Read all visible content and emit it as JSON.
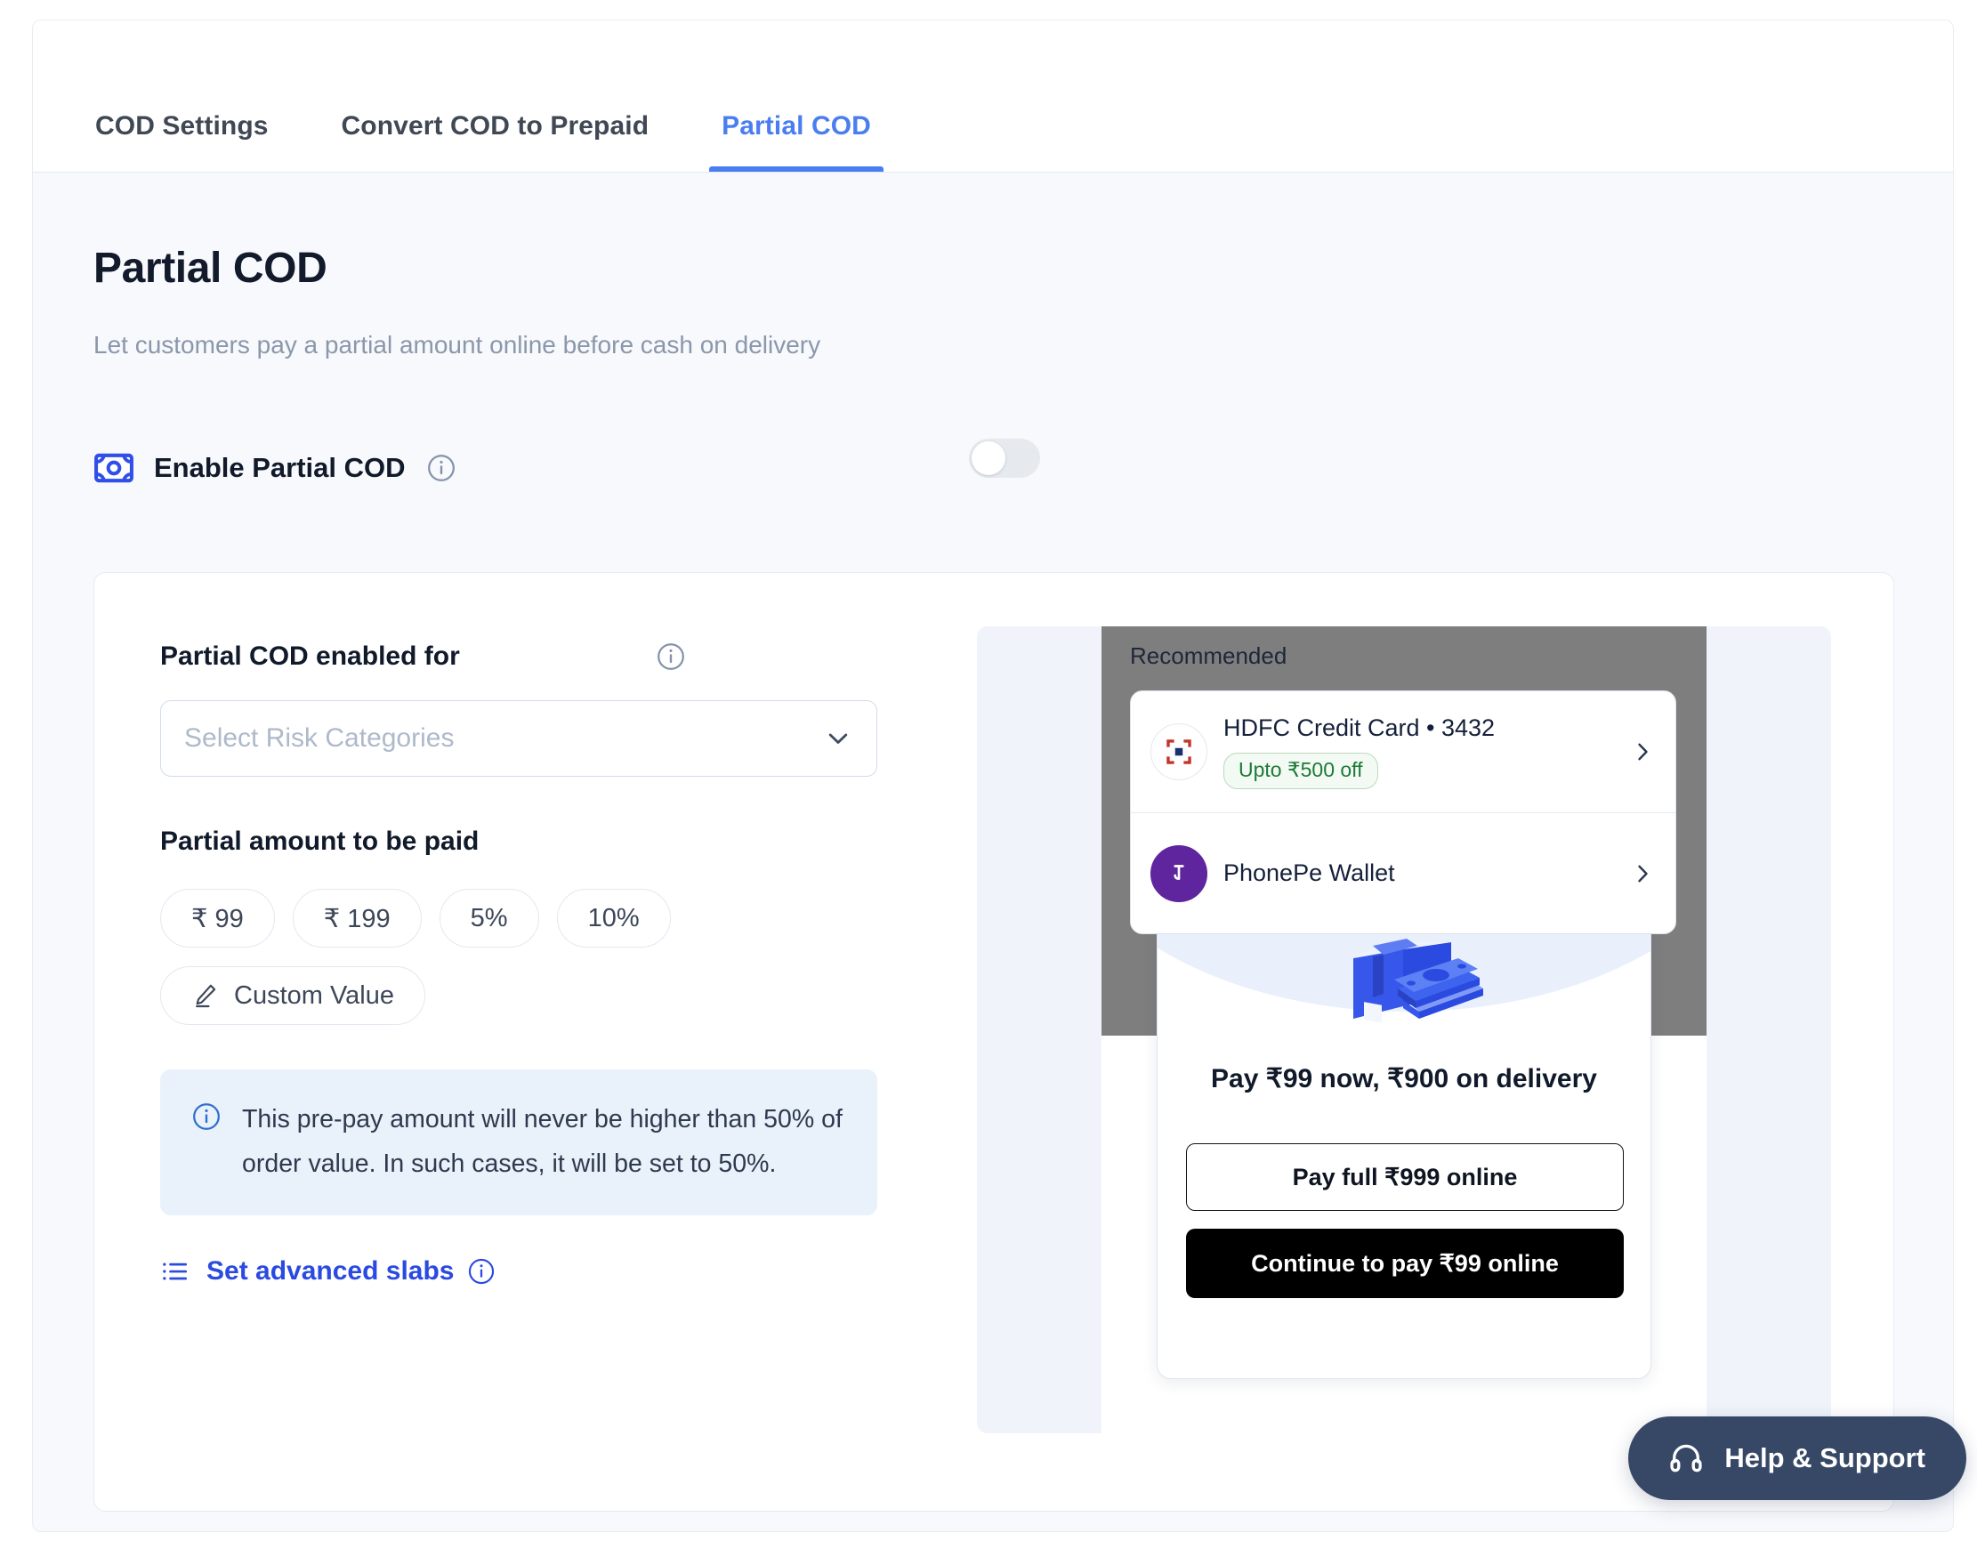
{
  "tabs": [
    {
      "label": "COD Settings",
      "active": false
    },
    {
      "label": "Convert COD to Prepaid",
      "active": false
    },
    {
      "label": "Partial COD",
      "active": true
    }
  ],
  "header": {
    "title": "Partial COD",
    "subtitle": "Let customers pay a partial amount online before cash on delivery"
  },
  "enable": {
    "label": "Enable Partial COD",
    "toggle_state": "off"
  },
  "form": {
    "risk_label": "Partial COD enabled for",
    "risk_placeholder": "Select Risk Categories",
    "amount_label": "Partial amount to be paid",
    "chips": [
      {
        "label": "₹ 99"
      },
      {
        "label": "₹ 199"
      },
      {
        "label": "5%"
      },
      {
        "label": "10%"
      }
    ],
    "custom_value_label": "Custom Value",
    "notice": "This pre-pay amount will never be higher than 50% of order value. In such cases, it will be set to 50%.",
    "advanced_slabs_label": "Set advanced slabs"
  },
  "preview": {
    "section_title": "Recommended",
    "methods": [
      {
        "name": "HDFC Credit Card • 3432",
        "badge": "Upto ₹500 off"
      },
      {
        "name": "PhonePe Wallet",
        "badge": ""
      }
    ],
    "modal": {
      "title": "Pay ₹99 now, ₹900 on delivery",
      "secondary_button": "Pay full ₹999 online",
      "primary_button": "Continue to pay ₹99 online"
    }
  },
  "help": {
    "label": "Help & Support"
  },
  "colors": {
    "accent_blue": "#4a7ef0",
    "link_blue": "#2a4ae0",
    "page_bg": "#f7f9fc",
    "notice_bg": "#e9f1fb",
    "help_bg": "#374866"
  }
}
